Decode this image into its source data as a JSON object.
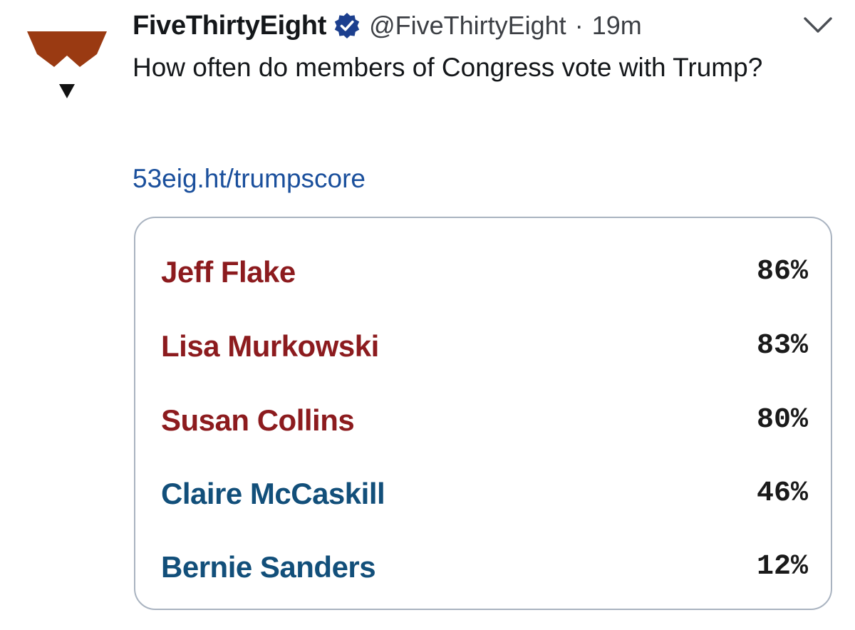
{
  "tweet": {
    "display_name": "FiveThirtyEight",
    "verified_icon": "verified-badge-icon",
    "handle": "@FiveThirtyEight",
    "separator": "·",
    "time": "19m",
    "text": "How often do members of Congress vote with Trump?",
    "link": "53eig.ht/trumpscore",
    "menu_icon": "chevron-down-icon",
    "avatar_icon": "fivethirtyeight-logo-icon"
  },
  "colors": {
    "republican": "#8c1b1e",
    "democrat": "#124f7a",
    "verified": "#1c3f8e",
    "link": "#1a4f9c",
    "logo": "#9a3a12"
  },
  "card": {
    "rows": [
      {
        "name": "Jeff Flake",
        "value": "86%",
        "party_color": "#8c1b1e"
      },
      {
        "name": "Lisa Murkowski",
        "value": "83%",
        "party_color": "#8c1b1e"
      },
      {
        "name": "Susan Collins",
        "value": "80%",
        "party_color": "#8c1b1e"
      },
      {
        "name": "Claire McCaskill",
        "value": "46%",
        "party_color": "#124f7a"
      },
      {
        "name": "Bernie Sanders",
        "value": "12%",
        "party_color": "#124f7a"
      }
    ]
  }
}
